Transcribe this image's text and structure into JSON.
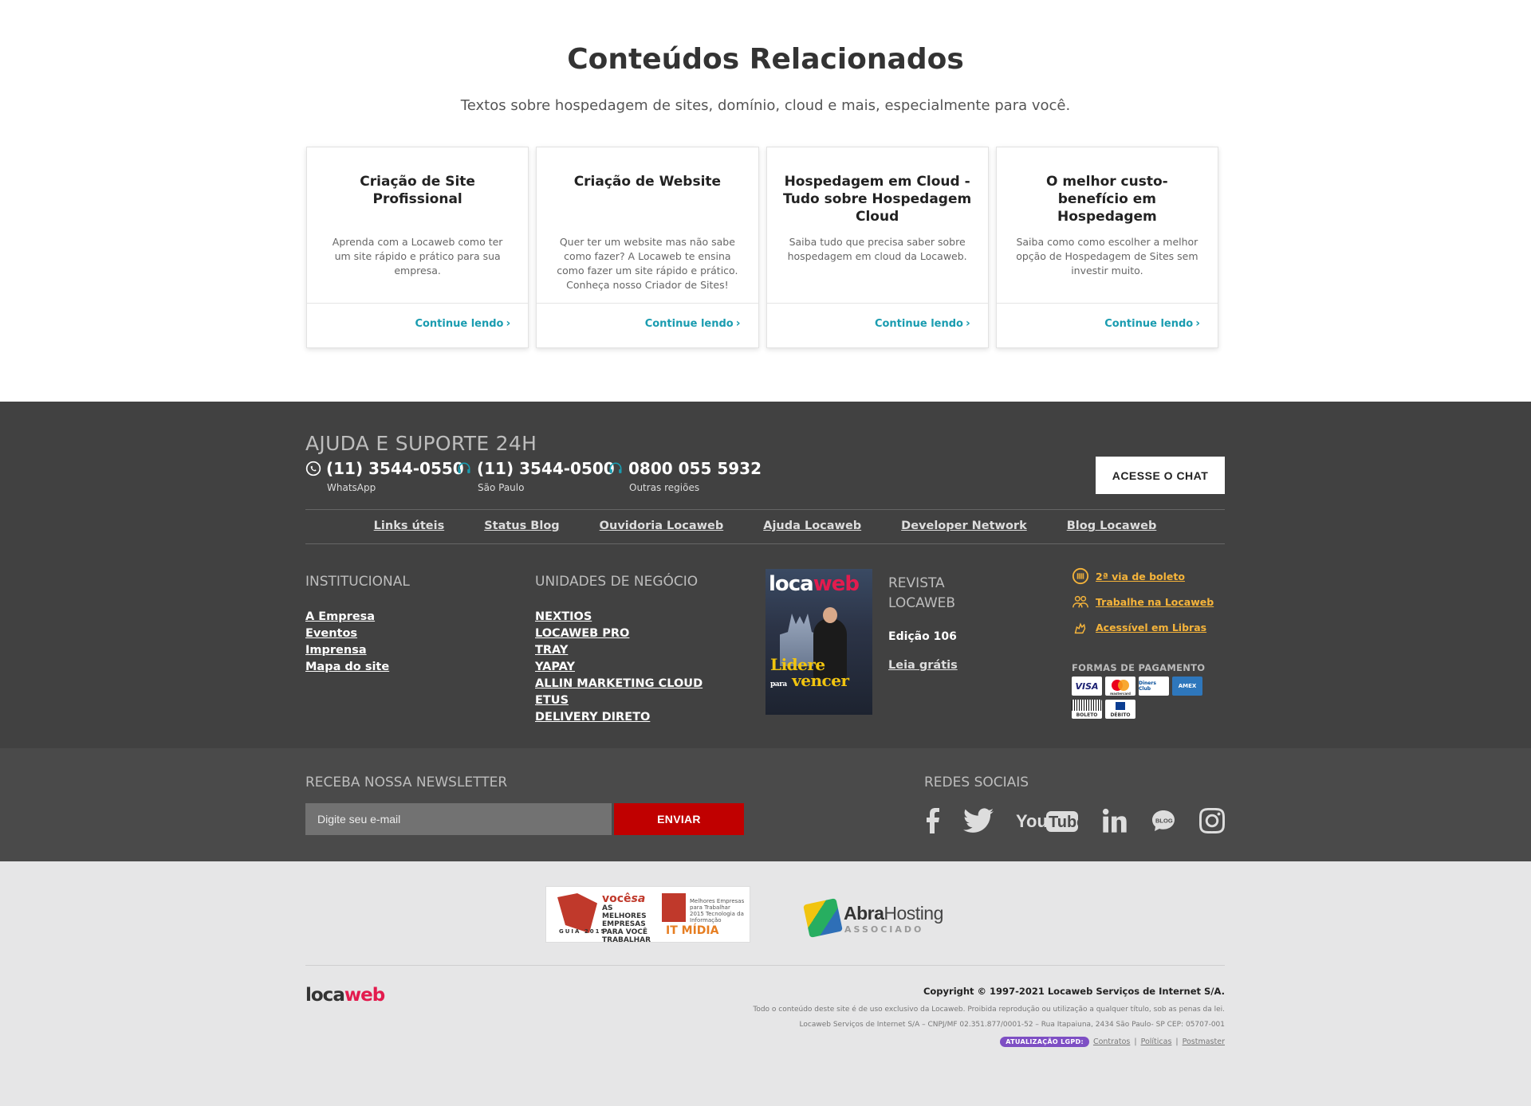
{
  "related": {
    "title": "Conteúdos Relacionados",
    "subtitle": "Textos sobre hospedagem de sites, domínio, cloud e mais, especialmente para você.",
    "cards": [
      {
        "title": "Criação de Site Profissional",
        "desc": "Aprenda com a Locaweb como ter um site rápido e prático para sua empresa.",
        "link": "Continue lendo"
      },
      {
        "title": "Criação de Website",
        "desc": "Quer ter um website mas não sabe como fazer? A Locaweb te ensina como fazer um site rápido e prático. Conheça nosso Criador de Sites!",
        "link": "Continue lendo"
      },
      {
        "title": "Hospedagem em Cloud - Tudo sobre Hospedagem Cloud",
        "desc": "Saiba tudo que precisa saber sobre hospedagem em cloud da Locaweb.",
        "link": "Continue lendo"
      },
      {
        "title": "O melhor custo-benefício em Hospedagem",
        "desc": "Saiba como como escolher a melhor opção de Hospedagem de Sites sem investir muito.",
        "link": "Continue lendo"
      }
    ]
  },
  "support": {
    "title": "AJUDA E SUPORTE 24H",
    "phones": [
      {
        "number": "(11) 3544-0550",
        "label": "WhatsApp",
        "icon": "whatsapp-icon"
      },
      {
        "number": "(11) 3544-0500",
        "label": "São Paulo",
        "icon": "headset-icon"
      },
      {
        "number": "0800 055 5932",
        "label": "Outras regiões",
        "icon": "headset-icon"
      }
    ],
    "chat_label": "ACESSE O CHAT"
  },
  "useful_links": [
    "Links úteis",
    "Status Blog",
    "Ouvidoria Locaweb",
    "Ajuda Locaweb",
    "Developer Network",
    "Blog Locaweb"
  ],
  "institucional": {
    "title": "INSTITUCIONAL",
    "links": [
      "A Empresa",
      "Eventos",
      "Imprensa",
      "Mapa do site"
    ]
  },
  "unidades": {
    "title": "UNIDADES DE NEGÓCIO",
    "links": [
      "NEXTIOS",
      "LOCAWEB PRO",
      "TRAY",
      "YAPAY",
      "ALLIN MARKETING CLOUD",
      "ETUS",
      "DELIVERY DIRETO"
    ]
  },
  "revista": {
    "title_line1": "REVISTA",
    "title_line2": "LOCAWEB",
    "edition": "Edição 106",
    "read": "Leia grátis",
    "cover_logo_a": "loca",
    "cover_logo_b": "web",
    "cover_text_a": "Lidere",
    "cover_text_b": "vencer",
    "cover_text_small": "para"
  },
  "quick_links": [
    {
      "label": "2ª via de boleto",
      "icon": "barcode-icon"
    },
    {
      "label": "Trabalhe na Locaweb",
      "icon": "people-icon"
    },
    {
      "label": "Acessível em Libras",
      "icon": "hands-icon"
    }
  ],
  "payment": {
    "title": "FORMAS DE PAGAMENTO",
    "row1": [
      "VISA",
      "mastercard",
      "Diners Club",
      "AMEX"
    ],
    "row2": [
      "BOLETO",
      "DÉBITO"
    ]
  },
  "newsletter": {
    "title": "RECEBA NOSSA NEWSLETTER",
    "placeholder": "Digite seu e-mail",
    "button": "ENVIAR"
  },
  "social": {
    "title": "REDES SOCIAIS",
    "items": [
      "facebook-icon",
      "twitter-icon",
      "youtube-icon",
      "linkedin-icon",
      "blog-icon",
      "instagram-icon"
    ]
  },
  "awards": {
    "voce_a": "você",
    "voce_b": "sa",
    "voce_text": "AS MELHORES EMPRESAS PARA VOCÊ TRABALHAR",
    "voce_guia": "GUIA 2015",
    "gptw": "Melhores Empresas para Trabalhar 2015 Tecnologia da Informação",
    "itmidia": "IT MÍDIA",
    "abra_a": "Abra",
    "abra_b": "Hosting",
    "abra_sub": "ASSOCIADO"
  },
  "bottom": {
    "logo_a": "loca",
    "logo_b": "web",
    "copyright": "Copyright © 1997-2021 Locaweb Serviços de Internet S/A.",
    "line1": "Todo o conteúdo deste site é de uso exclusivo da Locaweb. Proibida reprodução ou utilização a qualquer título, sob as penas da lei.",
    "line2": "Locaweb Serviços de Internet S/A – CNPJ/MF 02.351.877/0001-52 – Rua Itapaiuna, 2434 São Paulo- SP CEP: 05707-001",
    "lgpd_badge": "ATUALIZAÇÃO LGPD:",
    "lgpd_links": [
      "Contratos",
      "Políticas",
      "Postmaster"
    ]
  }
}
